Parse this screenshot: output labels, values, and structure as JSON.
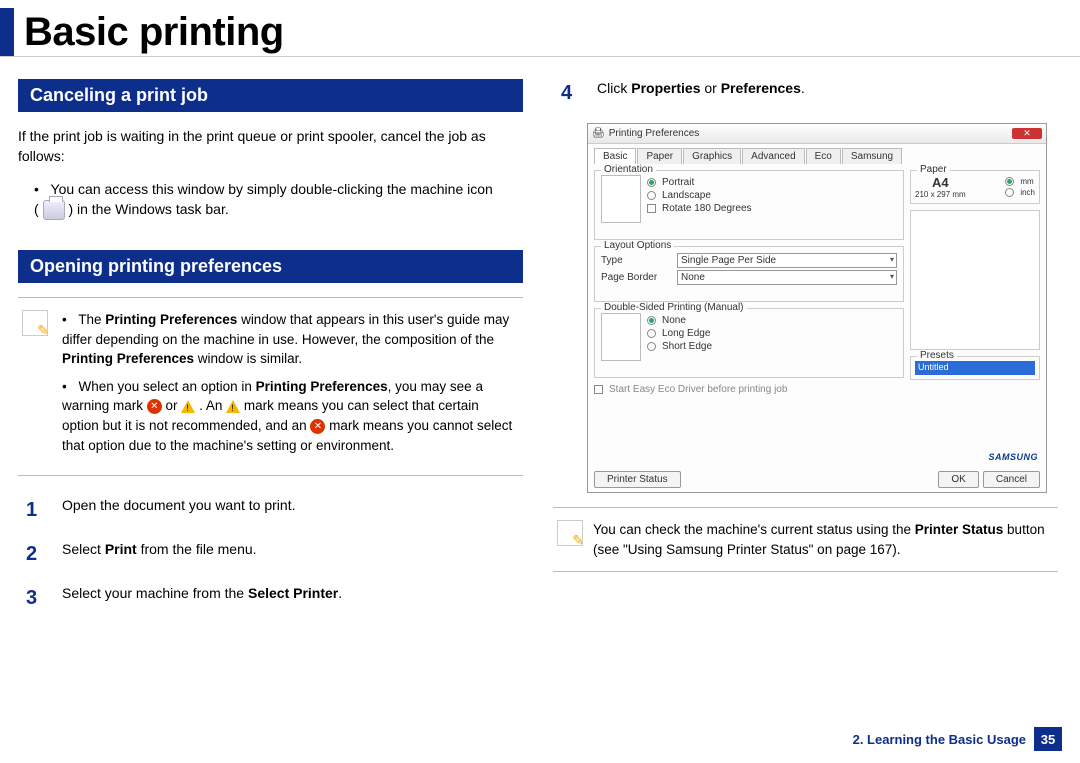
{
  "page_title": "Basic printing",
  "section_cancel": {
    "header": "Canceling a print job",
    "intro": "If the print job is waiting in the print queue or print spooler, cancel the job as follows:",
    "bullet_pre": "You can access this window by simply double-clicking the machine icon",
    "bullet_post": ") in the Windows task bar."
  },
  "section_prefs": {
    "header": "Opening printing preferences"
  },
  "note1": {
    "li1": {
      "pre": "The ",
      "b1": "Printing Preferences",
      "mid": " window that appears in this user's guide may differ depending on the machine in use. However, the composition of the ",
      "b2": "Printing Preferences",
      "post": " window is similar."
    },
    "li2": {
      "pre": "When you select an option in ",
      "b1": "Printing Preferences",
      "mid1": ", you may see a warning mark ",
      "mid2": " or ",
      "mid3": " . An ",
      "mid4": " mark means you can select that certain option but it is not recommended, and an ",
      "post": " mark means you cannot select that option due to the machine's setting or environment."
    }
  },
  "steps": {
    "s1": "Open the document you want to print.",
    "s2_pre": "Select ",
    "s2_b": "Print",
    "s2_post": " from the file menu.",
    "s3_pre": "Select your machine from the ",
    "s3_b": "Select Printer",
    "s3_post": ".",
    "s4_pre": "Click ",
    "s4_b1": "Properties",
    "s4_mid": " or ",
    "s4_b2": "Preferences",
    "s4_post": "."
  },
  "dialog": {
    "title": "Printing Preferences",
    "tabs": [
      "Basic",
      "Paper",
      "Graphics",
      "Advanced",
      "Eco",
      "Samsung"
    ],
    "orientation": {
      "legend": "Orientation",
      "portrait": "Portrait",
      "landscape": "Landscape",
      "rotate": "Rotate 180 Degrees"
    },
    "layout": {
      "legend": "Layout Options",
      "type_label": "Type",
      "type_value": "Single Page Per Side",
      "border_label": "Page Border",
      "border_value": "None"
    },
    "duplex": {
      "legend": "Double-Sided Printing (Manual)",
      "none": "None",
      "long": "Long Edge",
      "short": "Short Edge"
    },
    "eco_check": "Start Easy Eco Driver before printing job",
    "paper": {
      "legend": "Paper",
      "size": "A4",
      "dim": "210 x 297 mm",
      "mm": "mm",
      "inch": "inch"
    },
    "presets": {
      "legend": "Presets",
      "value": "Untitled"
    },
    "printer_status": "Printer Status",
    "ok": "OK",
    "cancel": "Cancel",
    "logo": "SAMSUNG"
  },
  "note2": {
    "pre": "You can check the machine's current status using the ",
    "b1": "Printer Status",
    "post": " button (see \"Using Samsung Printer Status\" on page 167)."
  },
  "footer": {
    "chapter": "2. Learning the Basic Usage",
    "page": "35"
  },
  "nums": {
    "n1": "1",
    "n2": "2",
    "n3": "3",
    "n4": "4"
  }
}
